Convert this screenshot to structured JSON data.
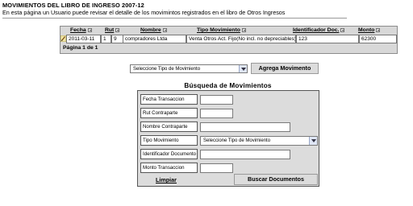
{
  "page": {
    "title": "MOVIMIENTOS DEL LIBRO DE INGRESO 2007-12",
    "description": "En esta página un Usuario puede revisar el detalle de los movimintos registrados en el libro de Otros Ingresos"
  },
  "grid": {
    "columns": [
      {
        "label": "Fecha",
        "sortable": true
      },
      {
        "label": "Rut",
        "sortable": true
      },
      {
        "label": "Nombre",
        "sortable": true
      },
      {
        "label": "Tipo Movimiento",
        "sortable": true
      },
      {
        "label": "Identificador Doc.",
        "sortable": true
      },
      {
        "label": "Monto",
        "sortable": true
      }
    ],
    "rows": [
      {
        "icon": "edit-icon",
        "fecha": "2011-03-11",
        "rut": "1",
        "dv": "9",
        "nombre": "compradores Ltda",
        "tipo": "Venta Otros Act. Fijo(No incl. no depreciables)",
        "identificador": "123",
        "monto": "62300"
      }
    ],
    "pager": "Página 1 de 1"
  },
  "toolbar": {
    "tipo_select_value": "Seleccione Tipo de Movimiento",
    "add_button": "Agrega Movimento"
  },
  "search": {
    "title": "Búsqueda de Movimientos",
    "fields": [
      {
        "label": "Fecha Transaccion",
        "value": ""
      },
      {
        "label": "Rut Contraparte",
        "value": ""
      },
      {
        "label": "Nombre Contraparte",
        "value": ""
      },
      {
        "label": "Tipo Movimiento",
        "value": "Seleccione Tipo de Movimiento"
      },
      {
        "label": "Identificador Documento",
        "value": ""
      },
      {
        "label": "Monto Transaccion",
        "value": ""
      }
    ],
    "clear_link": "Limpiar",
    "search_button": "Buscar Documentos"
  },
  "colors": {
    "grid_bg": "#d8d8d8",
    "panel_bg": "#dcdcdc",
    "select_arrow_bg": "#dfe6f5"
  }
}
